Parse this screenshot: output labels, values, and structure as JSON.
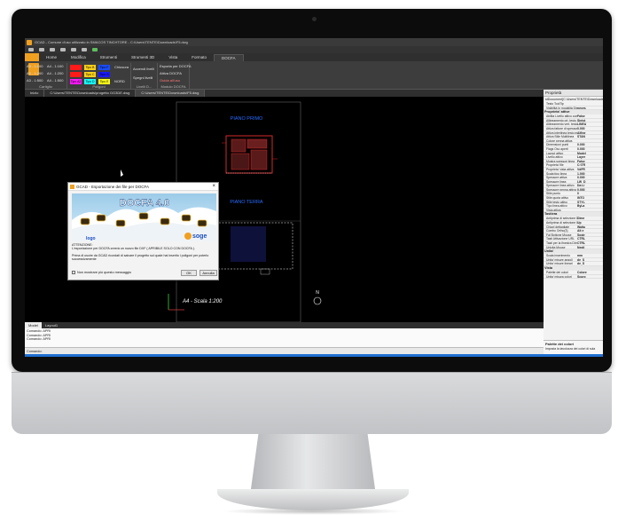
{
  "window": {
    "title": "GCAD - Comune d'uso utilizzato in SMACOS TINCHTORE - C:\\Users\\TENTE\\Downloads\\F5.dwg"
  },
  "ribbon_tabs": [
    {
      "label": ""
    },
    {
      "label": "Home"
    },
    {
      "label": "Modifica"
    },
    {
      "label": "Strumenti"
    },
    {
      "label": "Strumenti 3D"
    },
    {
      "label": "Vista"
    },
    {
      "label": "Formato"
    },
    {
      "label": "DOCFA"
    }
  ],
  "ribbon": {
    "cartiglio": {
      "title": "Cartiglio",
      "items": [
        "A3 - 1:100",
        "A4 - 1:100",
        "A3 - 1:200",
        "A4 - 1:200",
        "A3 - 1:500",
        "A4 - 1:500"
      ]
    },
    "poligoni": {
      "title": "Poligoni",
      "swatches": [
        {
          "label": "",
          "color": "#ff1a1a"
        },
        {
          "label": "Tipo B",
          "color": "#ffd21a"
        },
        {
          "label": "Tipo F",
          "color": "#1a4dff"
        },
        {
          "label": "",
          "color": "#ff1a1a"
        },
        {
          "label": "Tipo C",
          "color": "#ffd21a"
        },
        {
          "label": "Tipo G",
          "color": "#1a1aff"
        },
        {
          "label": "Tipo A2",
          "color": "#ff1aff"
        },
        {
          "label": "Tipo D",
          "color": "#1affff"
        },
        {
          "label": "Tipo E",
          "color": "#ffff1a"
        }
      ],
      "side": [
        "Chiusura",
        "",
        "NORD"
      ]
    },
    "livelli": {
      "title": "Livelli D...",
      "items": [
        "Accendi livelli",
        "Spegni livelli"
      ]
    },
    "docfa": {
      "title": "Modulo DOCFA",
      "items": [
        "Esporta per DOCFA",
        "Attiva DOCFA",
        "Guida all'uso"
      ]
    }
  },
  "doc_tabs": [
    {
      "label": "Inizio"
    },
    {
      "label": "C:\\Users\\TENTE\\Downloads\\progetto GG3DE.dwg"
    },
    {
      "label": "C:\\Users\\TENTE\\Downloads\\F5.dwg"
    }
  ],
  "drawing": {
    "label_first_floor": "PIANO PRIMO",
    "label_ground_floor": "PIANO TERRA",
    "scale_label": "A4 - Scala 1:200",
    "north_label": "N"
  },
  "dialog": {
    "title": "GCAD - Esportazione dei file per DOCFA",
    "banner_logo_left": "logo",
    "banner_logo_right": "soge",
    "banner_headline": "DOCFA 4.0",
    "attention_title": "ATTENZIONE:",
    "line1": "L'esportazione per DOCFA creerà un nuovo file DXF ( APRIBILE SOLO CON DOCFA ).",
    "line2": "Prima di uscire da GCAD ricordati di salvare il progetto sul quale hai inserito i poligoni per poterlo successivamente",
    "checkbox": "Non mostrare più questo messaggio",
    "ok": "OK",
    "cancel": "Annulla"
  },
  "model_tabs": [
    "Model",
    "Layout1"
  ],
  "command_history": [
    "Comando: APRI",
    "Comando: APRI",
    "Comando: APRI"
  ],
  "command_prompt": "Comando:",
  "properties": {
    "title": "Proprietà",
    "path": "stDocument[C:\\Users\\TENTE\\Downloads",
    "rows": [
      {
        "k": "Testo ToolTip",
        "v": ""
      },
      {
        "k": "Visibilità in modalità Disegno",
        "v": "neces"
      },
      {
        "cat": "Proprieta' attive"
      },
      {
        "k": "Abilita Livello attivo congelato",
        "v": "False"
      },
      {
        "k": "Allineamento ort. testo",
        "v": "Sinist"
      },
      {
        "k": "Allineamento vert. testo",
        "v": "LINEA"
      },
      {
        "k": "Attiva fattore di spessore",
        "v": "0.000"
      },
      {
        "k": "Attiva interlinea testo multi",
        "v": "Alfine"
      },
      {
        "k": "Attiva Stile Multilinea",
        "v": "STAN"
      },
      {
        "k": "Colore penna attiva",
        "v": ""
      },
      {
        "k": "Dimensioni punti",
        "v": "0.000"
      },
      {
        "k": "Flags Osc aperti",
        "v": "0.000"
      },
      {
        "k": "Layout attivo",
        "v": "Model"
      },
      {
        "k": "Livello attivo",
        "v": "Layer"
      },
      {
        "k": "Mostra spessori linea",
        "v": "False"
      },
      {
        "k": "Proprieta' file",
        "v": "C:\\TR"
      },
      {
        "k": "Proprieta' vista attiva",
        "v": "VdFR"
      },
      {
        "k": "Scala tipo linea",
        "v": "1.000"
      },
      {
        "k": "Spessore attiva",
        "v": "0.000"
      },
      {
        "k": "Spessore linea",
        "v": "LW_D"
      },
      {
        "k": "Spessore linea attivo",
        "v": "Da Li"
      },
      {
        "k": "Spessore penna attiva",
        "v": "0.000"
      },
      {
        "k": "Stile punto",
        "v": "0"
      },
      {
        "k": "Stile quota attivo",
        "v": "INTO"
      },
      {
        "k": "Stile testo attivo",
        "v": "STYL"
      },
      {
        "k": "Tipo linea attivo",
        "v": "ByLa"
      },
      {
        "k": "Vista attiva",
        "v": ""
      },
      {
        "cat": "Tastiera"
      },
      {
        "k": "Antiprima di selezione Dim",
        "v": "Dime"
      },
      {
        "k": "Antiprima di selezione Up",
        "v": "Up"
      },
      {
        "k": "Chiavi dettagliate",
        "v": "Waltu"
      },
      {
        "k": "Combo Ortho(3)",
        "v": "Alt e"
      },
      {
        "k": "Fai Bottone Mouse",
        "v": "Sostr"
      },
      {
        "k": "Tasti Attivazione URL",
        "v": "CTRL"
      },
      {
        "k": "Tasti per la finestra Dime",
        "v": "CTRL"
      },
      {
        "k": "Unicita Mouse",
        "v": "Negli"
      },
      {
        "cat": "Unita'"
      },
      {
        "k": "Scala inserimento",
        "v": "mm"
      },
      {
        "k": "Unita' misure angoli",
        "v": "de_S"
      },
      {
        "k": "Unita' misure lineari",
        "v": "de_S"
      },
      {
        "cat": "Vista"
      },
      {
        "k": "Palette dei colori",
        "v": "Colore"
      },
      {
        "k": "Unita' misura colori",
        "v": "Scuro"
      }
    ],
    "footer_title": "Palette dei colori",
    "footer_text": "Imposta la tavolozza dei colori di sula"
  },
  "colors": {
    "accent": "#f0a020",
    "drawing_blue": "#2a6cff",
    "plan_red": "#d42a2a",
    "status_blue": "#1e6fd0"
  }
}
